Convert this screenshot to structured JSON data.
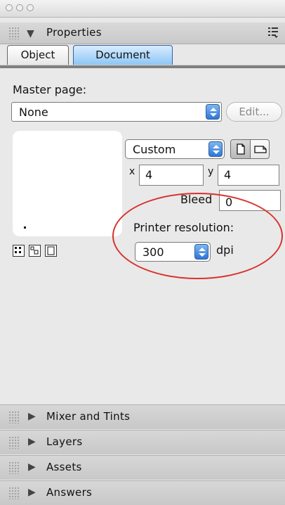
{
  "window": {
    "controls": [
      "close",
      "minimize",
      "zoom"
    ]
  },
  "panel": {
    "title": "Properties",
    "tabs": [
      {
        "label": "Object",
        "active": false
      },
      {
        "label": "Document",
        "active": true
      }
    ]
  },
  "document": {
    "master_page_label": "Master page:",
    "master_page_value": "None",
    "edit_button": "Edit...",
    "page_size_value": "Custom",
    "x_label": "x",
    "x_value": "4",
    "y_label": "y",
    "y_value": "4",
    "bleed_label": "Bleed",
    "bleed_value": "0",
    "printer_resolution_label": "Printer resolution:",
    "resolution_value": "300",
    "dpi_label": "dpi"
  },
  "collapsed_panels": [
    {
      "title": "Mixer and Tints"
    },
    {
      "title": "Layers"
    },
    {
      "title": "Assets"
    },
    {
      "title": "Answers"
    }
  ],
  "colors": {
    "accent_blue": "#2e77d8",
    "annotation_red": "#d9322f"
  },
  "icons": {
    "disclosure_open": "triangle-down-icon",
    "disclosure_closed": "triangle-right-icon",
    "panel_menu": "panel-menu-icon",
    "portrait": "portrait-orientation-icon",
    "landscape": "landscape-orientation-icon"
  }
}
